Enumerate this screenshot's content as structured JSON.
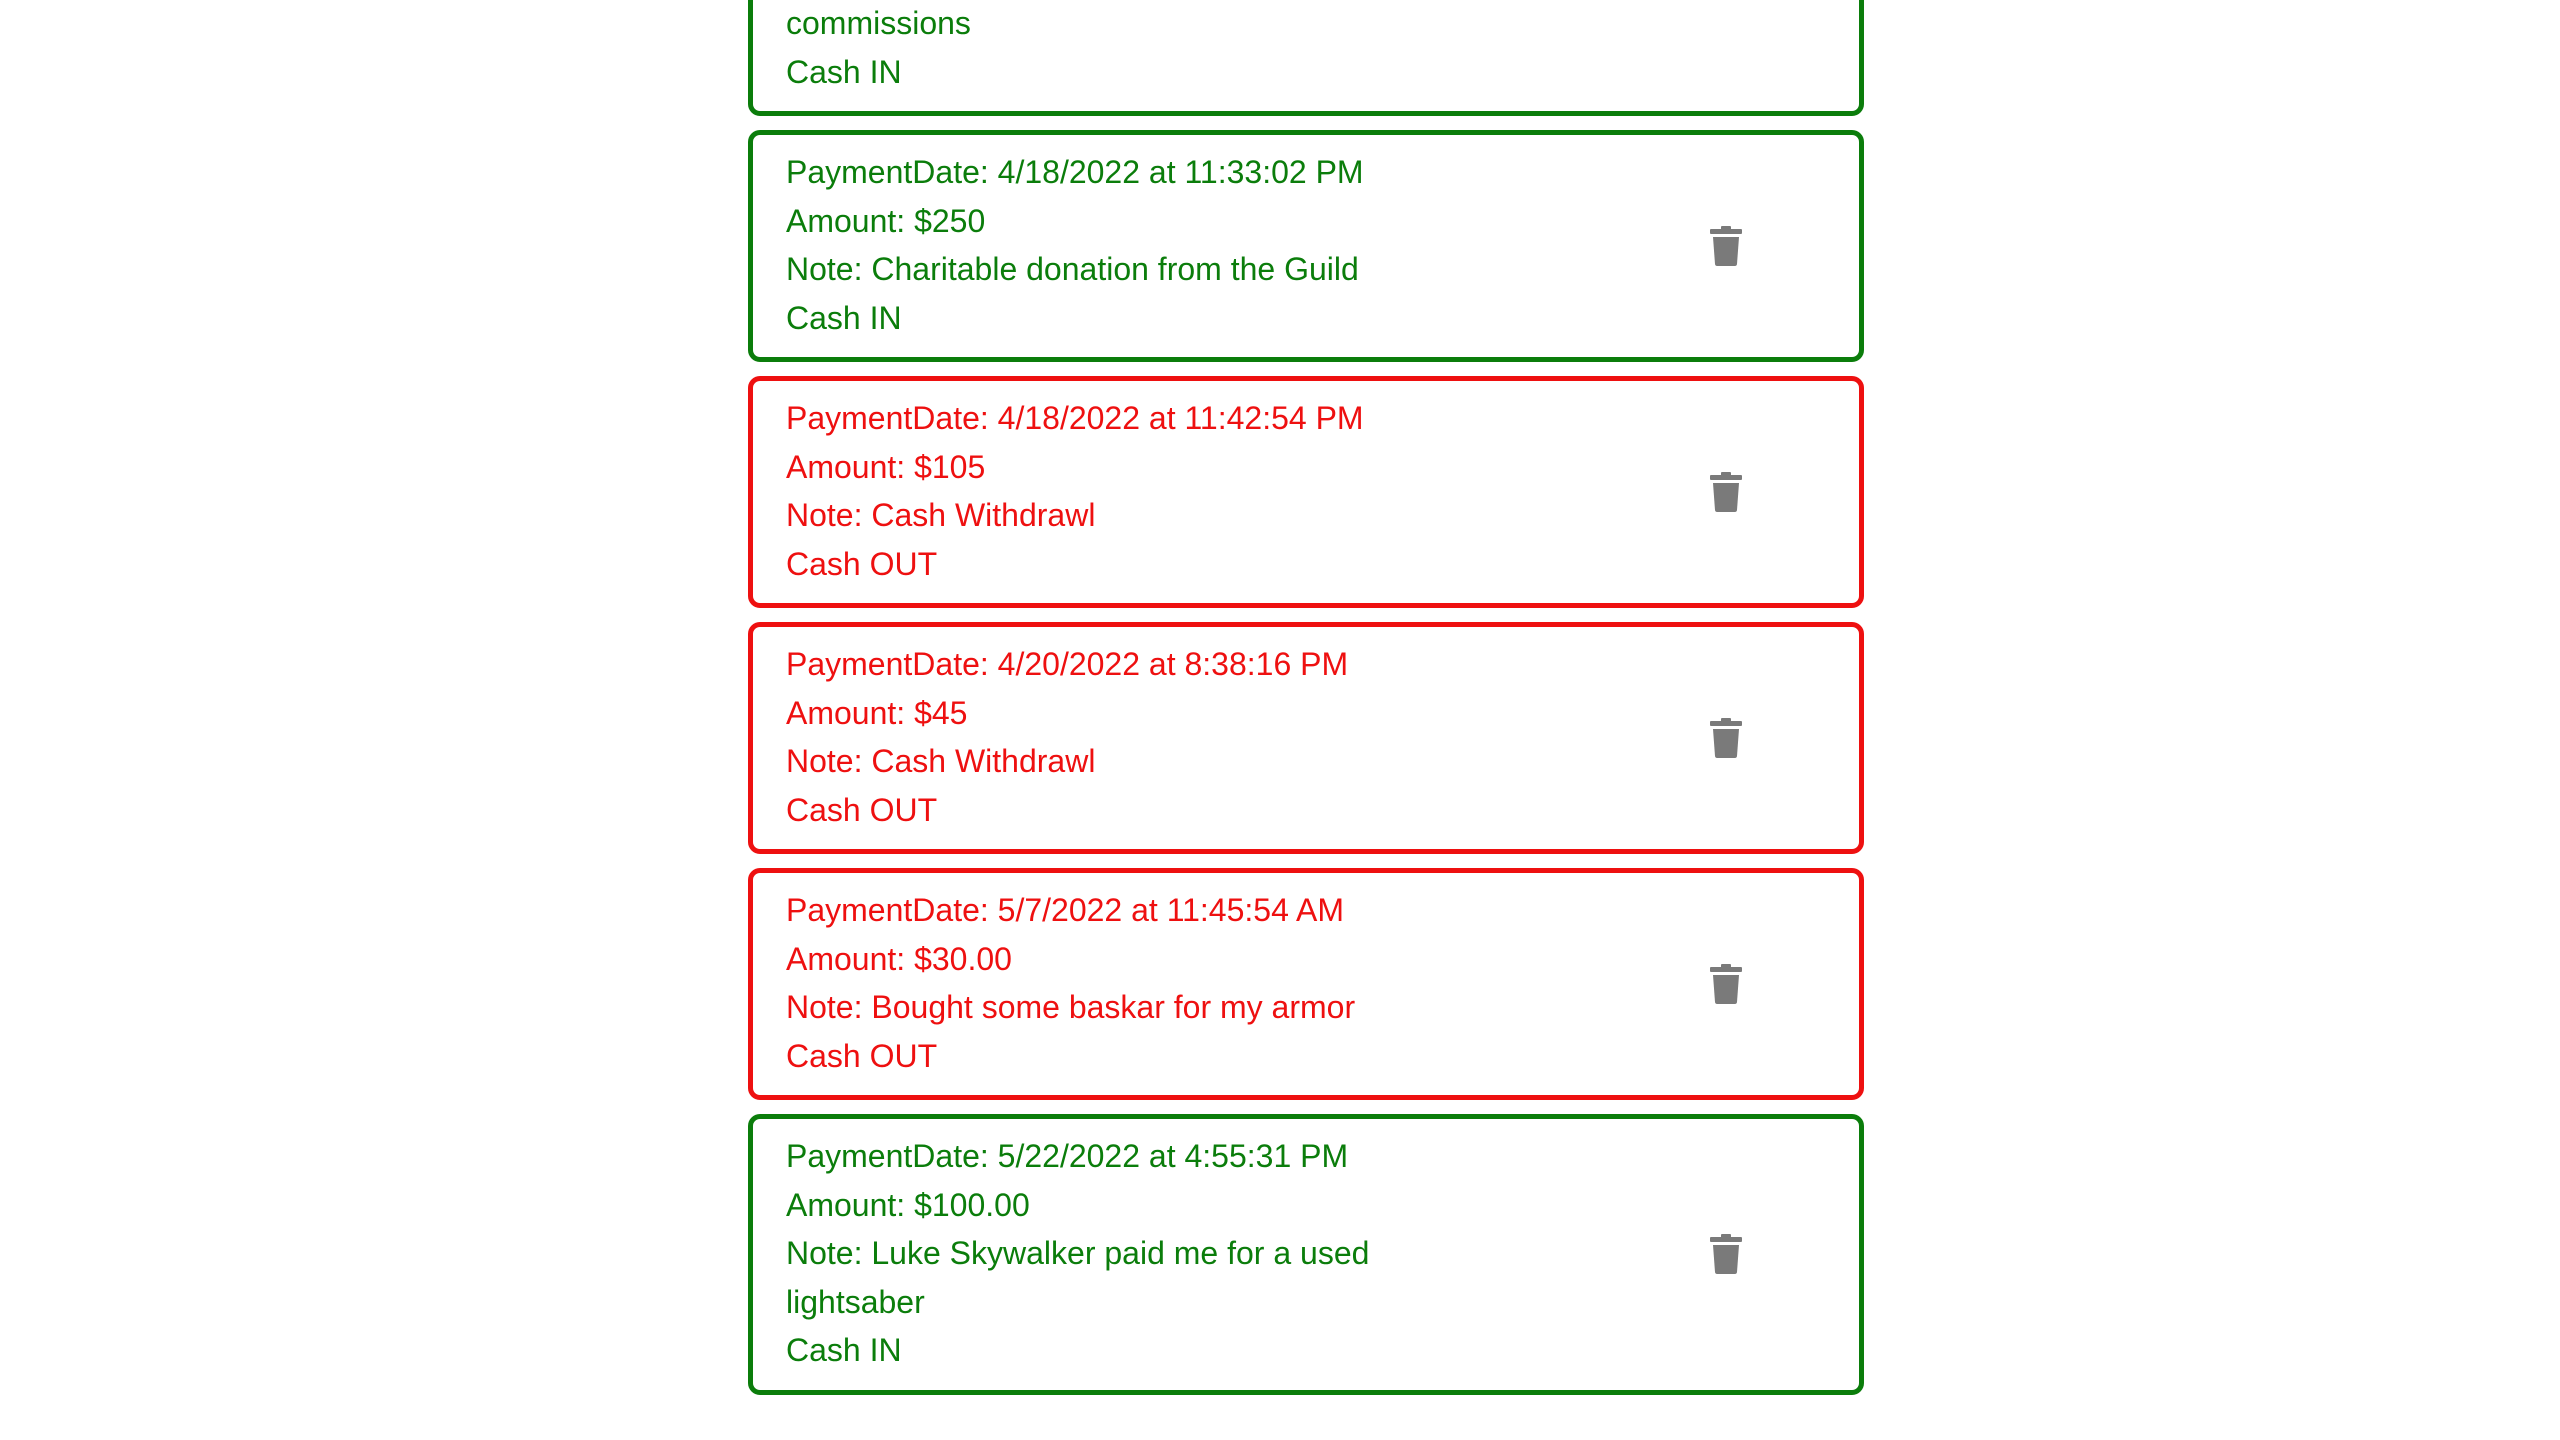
{
  "colors": {
    "cash_in": "#0b7d0b",
    "cash_out": "#ee1010",
    "trash_icon": "#7a7a7a"
  },
  "payments": [
    {
      "type": "in",
      "date": "",
      "amount": "",
      "note": "commissions",
      "direction": "Cash IN",
      "icon": "trash-icon",
      "visible_lines_only": [
        "note",
        "direction"
      ]
    },
    {
      "type": "in",
      "date": "PaymentDate: 4/18/2022 at 11:33:02 PM",
      "amount": "Amount: $250",
      "note": "Note: Charitable donation from the Guild",
      "direction": "Cash IN",
      "icon": "trash-icon"
    },
    {
      "type": "out",
      "date": "PaymentDate: 4/18/2022 at 11:42:54 PM",
      "amount": "Amount: $105",
      "note": "Note: Cash Withdrawl",
      "direction": "Cash OUT",
      "icon": "trash-icon"
    },
    {
      "type": "out",
      "date": "PaymentDate: 4/20/2022 at 8:38:16 PM",
      "amount": "Amount: $45",
      "note": "Note: Cash Withdrawl",
      "direction": "Cash OUT",
      "icon": "trash-icon"
    },
    {
      "type": "out",
      "date": "PaymentDate: 5/7/2022 at 11:45:54 AM",
      "amount": "Amount: $30.00",
      "note": "Note: Bought some baskar for my armor",
      "direction": "Cash OUT",
      "icon": "trash-icon"
    },
    {
      "type": "in",
      "date": "PaymentDate: 5/22/2022 at 4:55:31 PM",
      "amount": "Amount: $100.00",
      "note": "Note: Luke Skywalker paid me for a used lightsaber",
      "direction": "Cash IN",
      "icon": "trash-icon"
    }
  ]
}
